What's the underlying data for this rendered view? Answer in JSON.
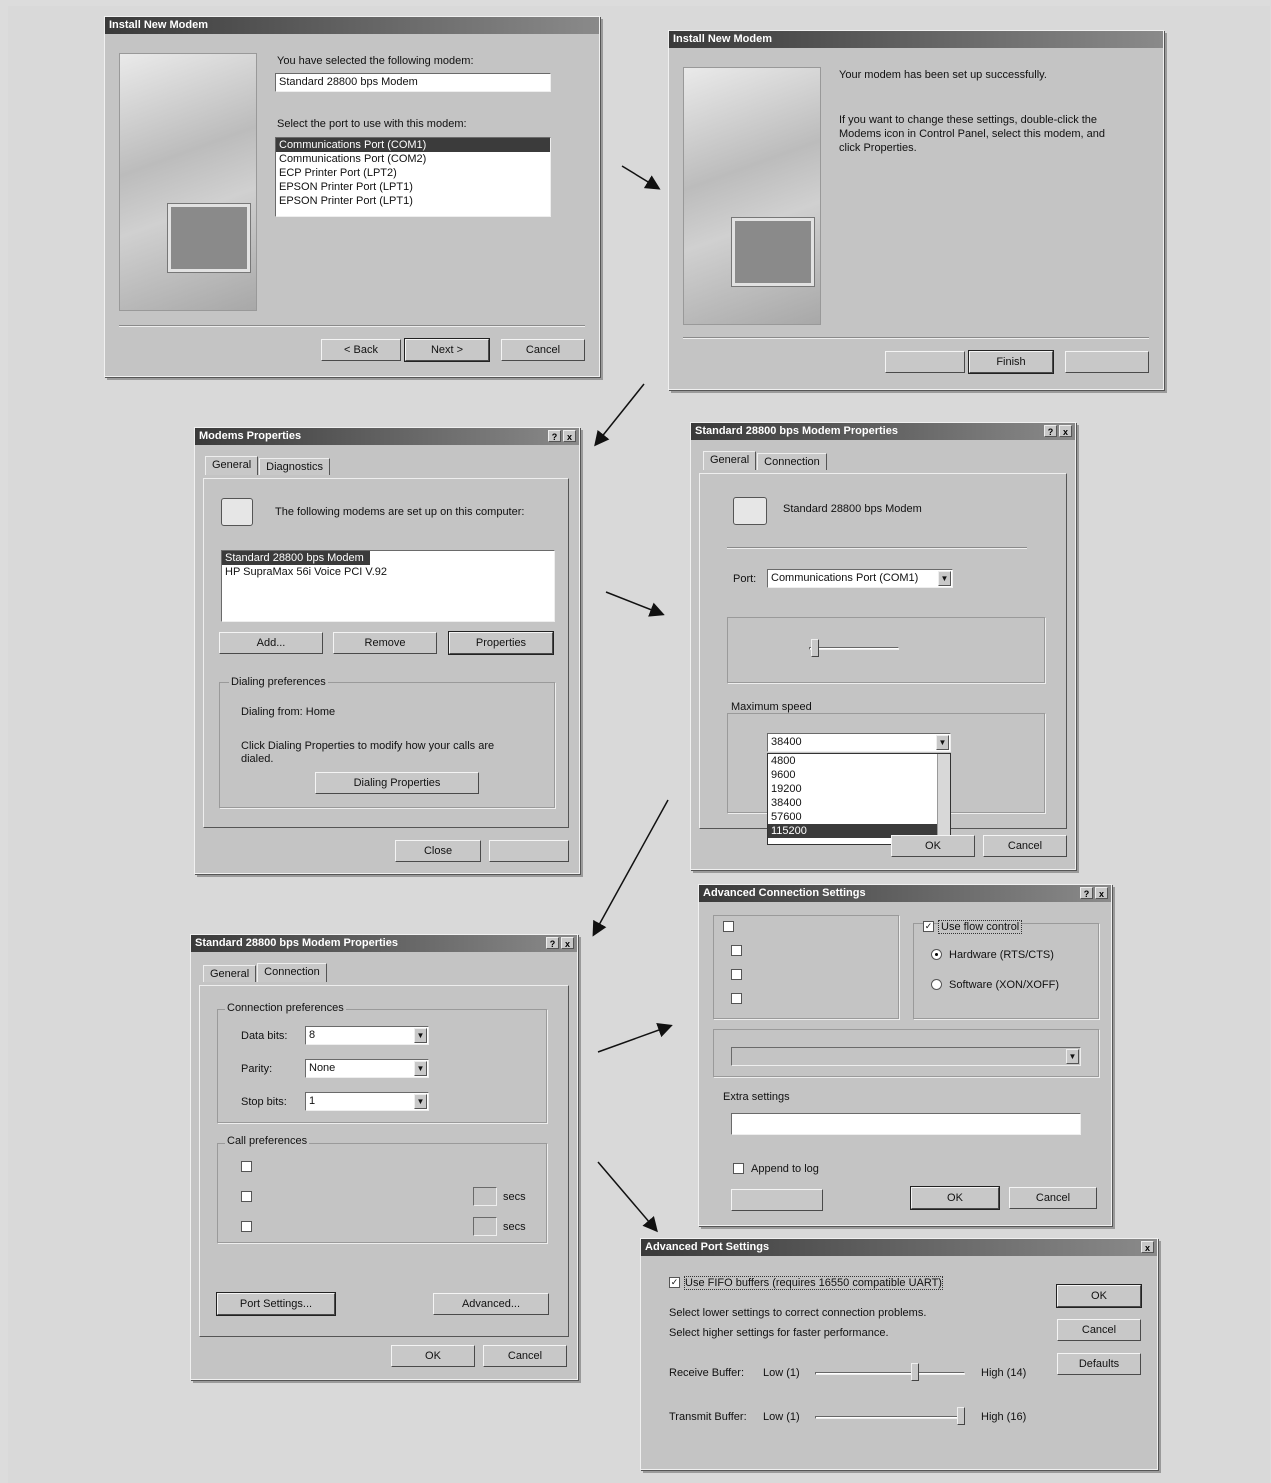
{
  "d1": {
    "title": "Install New Modem",
    "intro": "You have selected the following modem:",
    "modem": "Standard 28800 bps Modem",
    "port_prompt": "Select the port to use with this modem:",
    "ports": [
      "Communications Port (COM1)",
      "Communications Port (COM2)",
      "ECP Printer Port (LPT2)",
      "EPSON Printer Port (LPT1)",
      "EPSON Printer Port (LPT1)"
    ],
    "back": "< Back",
    "next": "Next >",
    "cancel": "Cancel"
  },
  "d2": {
    "title": "Install New Modem",
    "line1": "Your modem has been set up successfully.",
    "line2": "If you want to change these settings, double-click the Modems icon in Control Panel, select this modem, and click Properties.",
    "finish": "Finish"
  },
  "d3": {
    "title": "Modems Properties",
    "tab_general": "General",
    "tab_diag": "Diagnostics",
    "intro": "The following modems are set up on this computer:",
    "modems": [
      "Standard 28800 bps Modem",
      "HP SupraMax 56i Voice PCI V.92"
    ],
    "add": "Add...",
    "remove": "Remove",
    "properties": "Properties",
    "dialing_group": "Dialing preferences",
    "dialing_from": "Dialing from:   Home",
    "click_note": "Click Dialing Properties to modify how your calls are dialed.",
    "dialing_props": "Dialing Properties",
    "close": "Close"
  },
  "d4": {
    "title": "Standard 28800 bps Modem Properties",
    "tab_general": "General",
    "tab_connection": "Connection",
    "modem_name": "Standard 28800 bps Modem",
    "port_label": "Port:",
    "port_value": "Communications Port (COM1)",
    "max_speed": "Maximum speed",
    "speed_value": "38400",
    "speeds": [
      "4800",
      "9600",
      "19200",
      "38400",
      "57600",
      "115200"
    ],
    "cancel": "Cancel",
    "ok": "OK"
  },
  "d5": {
    "title": "Standard 28800 bps Modem Properties",
    "tab_general": "General",
    "tab_connection": "Connection",
    "conn_prefs": "Connection preferences",
    "data_bits_label": "Data bits:",
    "data_bits": "8",
    "parity_label": "Parity:",
    "parity": "None",
    "stop_bits_label": "Stop bits:",
    "stop_bits": "1",
    "call_prefs": "Call preferences",
    "secs1": "secs",
    "secs2": "secs",
    "port_settings": "Port Settings...",
    "advanced": "Advanced...",
    "ok": "OK",
    "cancel": "Cancel"
  },
  "d6": {
    "title": "Advanced Connection Settings",
    "use_flow": "Use flow control",
    "hardware": "Hardware (RTS/CTS)",
    "software": "Software (XON/XOFF)",
    "extra": "Extra settings",
    "append_log": "Append to log",
    "ok": "OK",
    "cancel": "Cancel"
  },
  "d7": {
    "title": "Advanced Port Settings",
    "fifo": "Use FIFO buffers (requires 16550 compatible UART)",
    "lower": "Select lower settings to correct connection problems.",
    "higher": "Select higher settings for faster performance.",
    "receive": "Receive Buffer:",
    "transmit": "Transmit Buffer:",
    "low1": "Low (1)",
    "high14": "High (14)",
    "low2": "Low (1)",
    "high16": "High (16)",
    "ok": "OK",
    "cancel": "Cancel",
    "defaults": "Defaults"
  },
  "help_glyph": "?",
  "close_glyph": "x"
}
